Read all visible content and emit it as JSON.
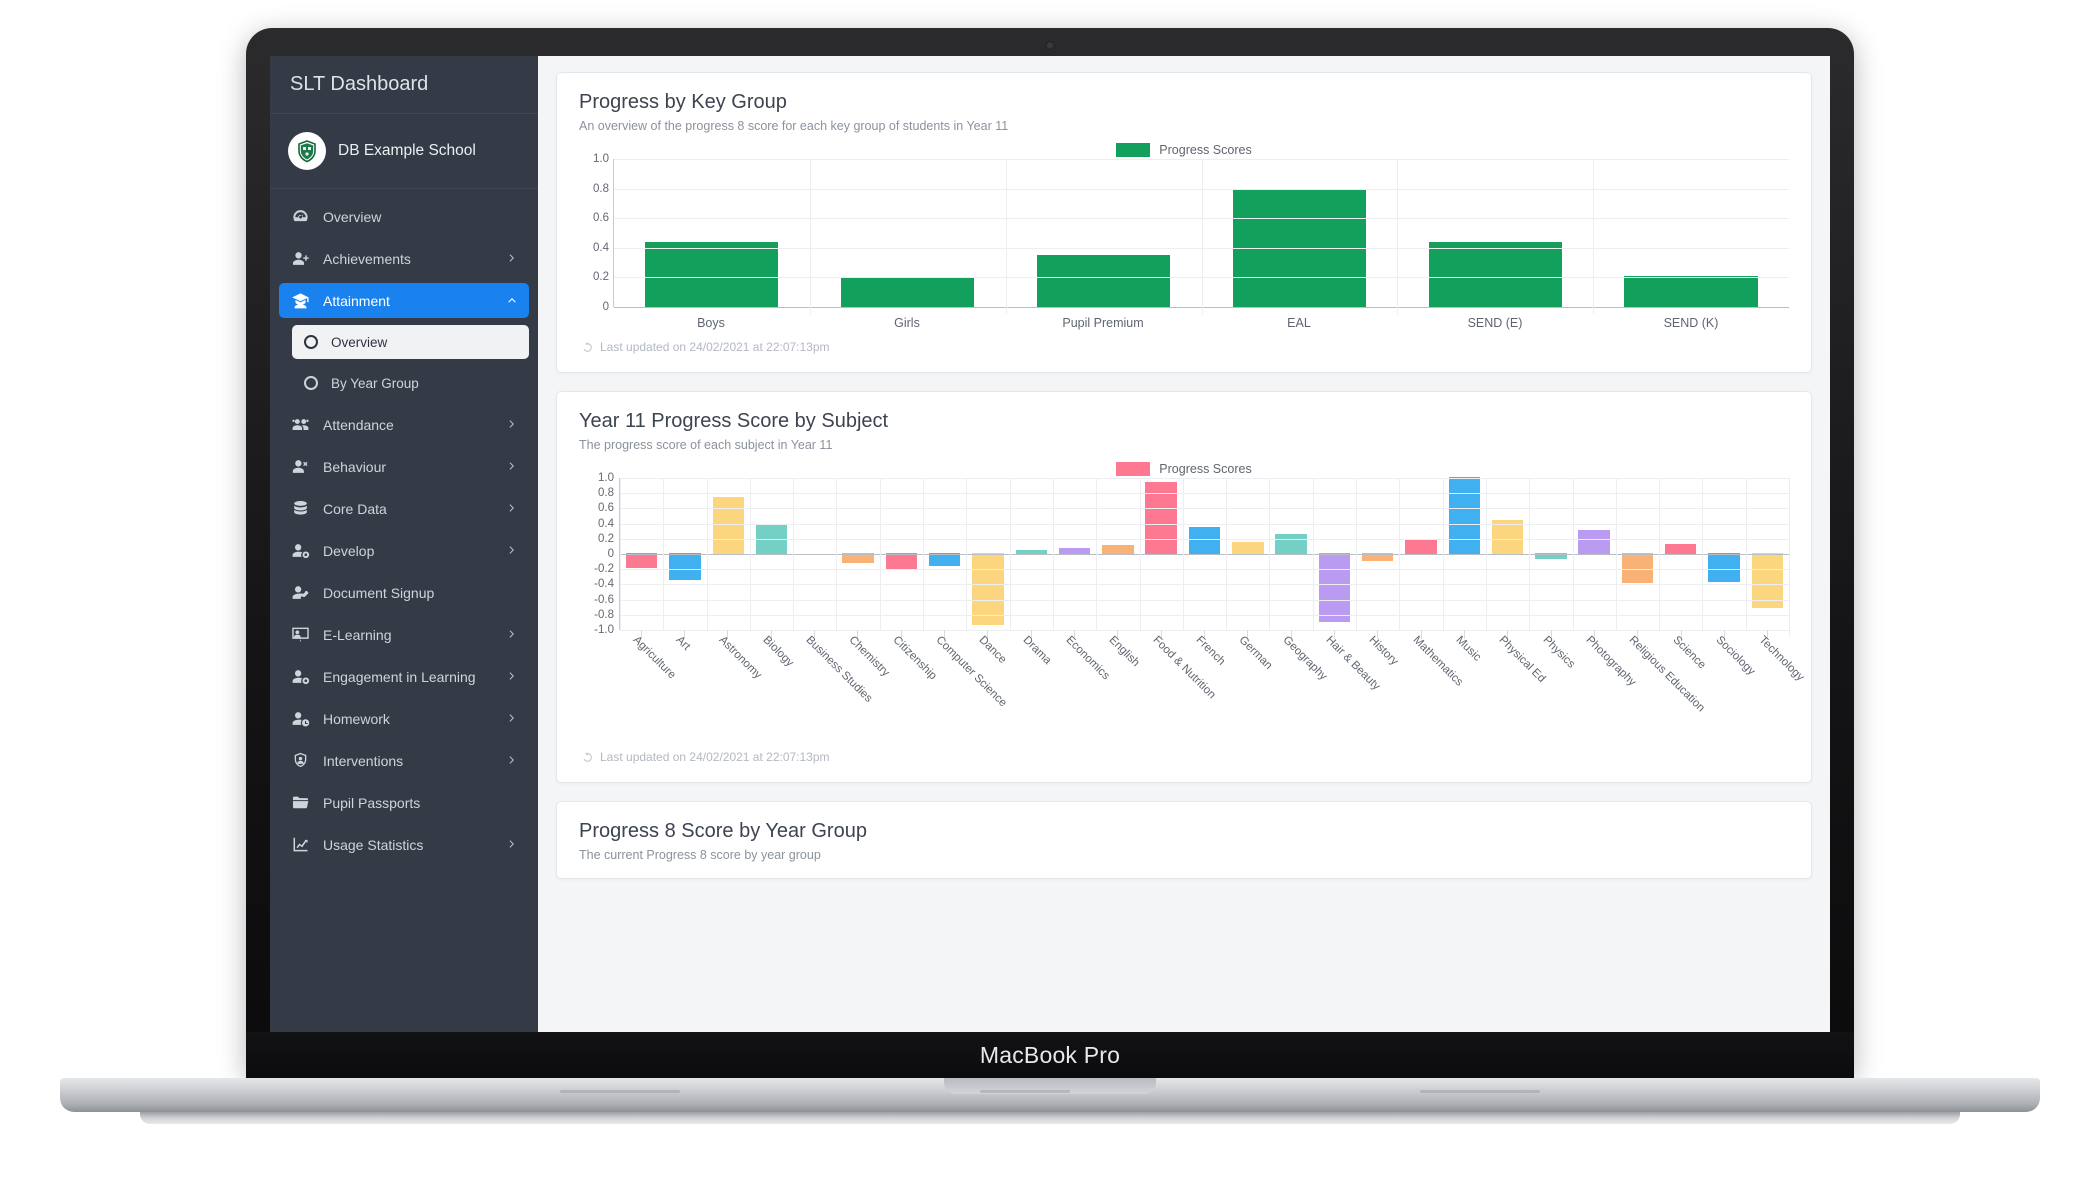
{
  "device": {
    "label": "MacBook Pro"
  },
  "sidebar": {
    "title": "SLT Dashboard",
    "school": "DB Example School",
    "items": [
      {
        "label": "Overview",
        "icon": "gauge-icon",
        "chevron": "",
        "active": false
      },
      {
        "label": "Achievements",
        "icon": "user-plus-icon",
        "chevron": "›",
        "active": false
      },
      {
        "label": "Attainment",
        "icon": "graduate-icon",
        "chevron": "^",
        "active": true
      },
      {
        "label": "Attendance",
        "icon": "users-icon",
        "chevron": "›",
        "active": false
      },
      {
        "label": "Behaviour",
        "icon": "user-times-icon",
        "chevron": "›",
        "active": false
      },
      {
        "label": "Core Data",
        "icon": "database-icon",
        "chevron": "›",
        "active": false
      },
      {
        "label": "Develop",
        "icon": "user-cog-icon",
        "chevron": "›",
        "active": false
      },
      {
        "label": "Document Signup",
        "icon": "user-edit-icon",
        "chevron": "",
        "active": false
      },
      {
        "label": "E-Learning",
        "icon": "presentation-icon",
        "chevron": "›",
        "active": false
      },
      {
        "label": "Engagement in Learning",
        "icon": "user-gear-icon",
        "chevron": "›",
        "active": false
      },
      {
        "label": "Homework",
        "icon": "user-clock-icon",
        "chevron": "›",
        "active": false
      },
      {
        "label": "Interventions",
        "icon": "user-shield-icon",
        "chevron": "›",
        "active": false
      },
      {
        "label": "Pupil Passports",
        "icon": "folder-icon",
        "chevron": "",
        "active": false
      },
      {
        "label": "Usage Statistics",
        "icon": "chart-line-icon",
        "chevron": "›",
        "active": false
      }
    ],
    "subitems": [
      {
        "label": "Overview",
        "selected": true
      },
      {
        "label": "By Year Group",
        "selected": false
      }
    ]
  },
  "cards": [
    {
      "title": "Progress by Key Group",
      "subtitle": "An overview of the progress 8 score for each key group of students in Year 11",
      "footer": "Last updated on 24/02/2021 at 22:07:13pm"
    },
    {
      "title": "Year 11 Progress Score by Subject",
      "subtitle": "The progress score of each subject in Year 11",
      "footer": "Last updated on 24/02/2021 at 22:07:13pm"
    },
    {
      "title": "Progress 8 Score by Year Group",
      "subtitle": "The current Progress 8 score by year group",
      "footer": ""
    }
  ],
  "colors": {
    "accent_blue": "#1a82ef",
    "sidebar_bg": "#343b46",
    "green": "#13a05c",
    "pink": "#fd7891",
    "blue": "#41b0f0",
    "yellow": "#fcd67f",
    "teal": "#74cfc4",
    "orange": "#f9b276",
    "purple": "#b99cf2"
  },
  "chart_data": [
    {
      "type": "bar",
      "title": "Progress by Key Group",
      "xlabel": "",
      "ylabel": "",
      "ylim": [
        0,
        1.0
      ],
      "yticks": [
        "1.0",
        "0.8",
        "0.6",
        "0.4",
        "0.2",
        "0"
      ],
      "grid": true,
      "legend": {
        "position": "top-center",
        "entries": [
          {
            "name": "Progress Scores",
            "color": "#13a05c"
          }
        ]
      },
      "categories": [
        "Boys",
        "Girls",
        "Pupil Premium",
        "EAL",
        "SEND (E)",
        "SEND (K)"
      ],
      "values": [
        0.44,
        0.2,
        0.35,
        0.8,
        0.44,
        0.21
      ]
    },
    {
      "type": "bar",
      "title": "Year 11 Progress Score by Subject",
      "xlabel": "",
      "ylabel": "",
      "ylim": [
        -1.0,
        1.0
      ],
      "yticks": [
        "1.0",
        "0.8",
        "0.6",
        "0.4",
        "0.2",
        "0",
        "-0.2",
        "-0.4",
        "-0.6",
        "-0.8",
        "-1.0"
      ],
      "grid": true,
      "legend": {
        "position": "top-center",
        "entries": [
          {
            "name": "Progress Scores",
            "color": "#fd7891"
          }
        ]
      },
      "categories": [
        "Agriculture",
        "Art",
        "Astronomy",
        "Biology",
        "Business Studies",
        "Chemistry",
        "Citizenship",
        "Computer Science",
        "Dance",
        "Drama",
        "Economics",
        "English",
        "Food & Nutrition",
        "French",
        "German",
        "Geography",
        "Hair & Beauty",
        "History",
        "Mathematics",
        "Music",
        "Physical Ed",
        "Physics",
        "Photography",
        "Religious Education",
        "Science",
        "Sociology",
        "Technology"
      ],
      "values": [
        -0.17,
        -0.33,
        0.74,
        0.37,
        0.0,
        -0.1,
        -0.2,
        -0.14,
        -0.92,
        0.04,
        0.07,
        0.1,
        0.94,
        0.34,
        0.14,
        0.25,
        -0.88,
        -0.08,
        0.19,
        1.0,
        0.43,
        -0.05,
        0.3,
        -0.37,
        0.12,
        -0.35,
        -0.7
      ],
      "bar_colors": [
        "#fd7891",
        "#41b0f0",
        "#fcd67f",
        "#74cfc4",
        "#b99cf2",
        "#f9b276",
        "#fd7891",
        "#41b0f0",
        "#fcd67f",
        "#74cfc4",
        "#b99cf2",
        "#f9b276",
        "#fd7891",
        "#41b0f0",
        "#fcd67f",
        "#74cfc4",
        "#b99cf2",
        "#f9b276",
        "#fd7891",
        "#41b0f0",
        "#fcd67f",
        "#74cfc4",
        "#b99cf2",
        "#f9b276",
        "#fd7891",
        "#41b0f0",
        "#fcd67f"
      ]
    }
  ]
}
